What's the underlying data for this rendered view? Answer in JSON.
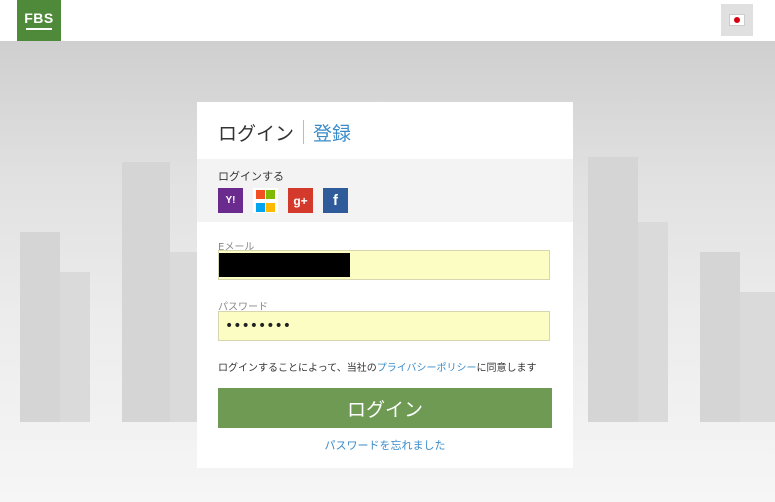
{
  "header": {
    "logo_text": "FBS",
    "language_flag_icon": "japan-flag-icon"
  },
  "login_card": {
    "tabs": {
      "login": "ログイン",
      "register": "登録"
    },
    "social": {
      "label": "ログインする",
      "icons": [
        "yahoo-icon",
        "microsoft-icon",
        "google-plus-icon",
        "facebook-icon"
      ],
      "yahoo_text": "Y!",
      "google_text": "g+",
      "facebook_text": "f"
    },
    "email": {
      "label": "Eメール",
      "value": ""
    },
    "password": {
      "label": "パスワード",
      "value": "••••••••"
    },
    "consent": {
      "prefix": "ログインすることによって、当社の",
      "link": "プライバシーポリシー",
      "suffix": "に同意します"
    },
    "login_button": "ログイン",
    "forgot_password": "パスワードを忘れました"
  },
  "colors": {
    "brand_green": "#4f8a3a",
    "button_green": "#6f9a54",
    "link_blue": "#3a8bc9",
    "autofill_yellow": "#fbfdc3"
  }
}
